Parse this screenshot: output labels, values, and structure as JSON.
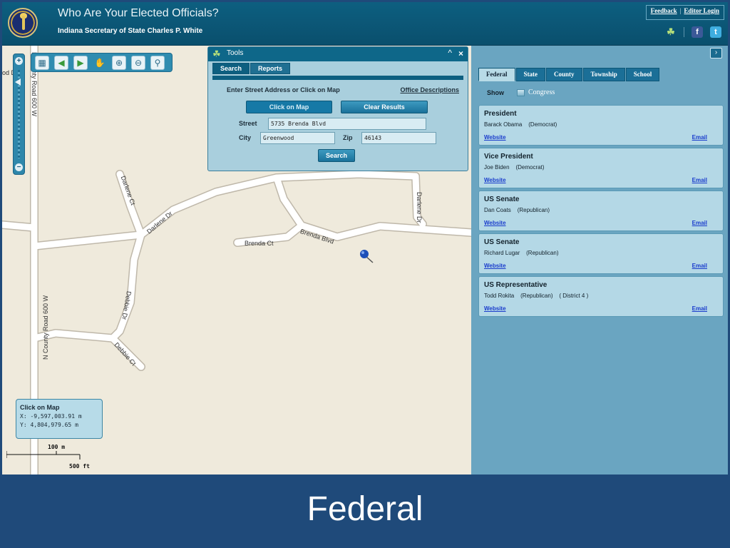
{
  "header": {
    "title": "Who Are Your Elected Officials?",
    "subtitle": "Indiana Secretary of State Charles P. White",
    "feedback": "Feedback",
    "separator": "|",
    "editor_login": "Editor Login"
  },
  "map": {
    "roads": [
      "N County Road 600 W",
      "N County Road 600 W",
      "Darlene Ct",
      "Darlene Dr",
      "Darlene Dr",
      "Brenda Blvd",
      "Brenda Ct",
      "Debbie Dr",
      "Debbie Ct",
      "od D"
    ],
    "coords": {
      "title": "Click on Map",
      "x": "X: -9,597,003.91 m",
      "y": "Y: 4,804,979.65 m"
    },
    "scale": {
      "metric": "100 m",
      "imperial": "500 ft"
    }
  },
  "tools": {
    "title": "Tools",
    "tabs": [
      "Search",
      "Reports"
    ],
    "enter_label": "Enter Street Address or Click on Map",
    "office_descriptions": "Office Descriptions",
    "click_on_map": "Click on Map",
    "clear_results": "Clear Results",
    "street_label": "Street",
    "street_value": "5735 Brenda Blvd",
    "city_label": "City",
    "city_value": "Greenwood",
    "zip_label": "Zip",
    "zip_value": "46143",
    "search": "Search"
  },
  "panel": {
    "tabs": [
      "Federal",
      "State",
      "County",
      "Township",
      "School"
    ],
    "show_label": "Show",
    "congress_label": "Congress",
    "officials": [
      {
        "office": "President",
        "detail": "Barack Obama    (Democrat)",
        "website": "Website",
        "email": "Email"
      },
      {
        "office": "Vice President",
        "detail": "Joe Biden    (Democrat)",
        "website": "Website",
        "email": "Email"
      },
      {
        "office": "US Senate",
        "detail": "Dan Coats    (Republican)",
        "website": "Website",
        "email": "Email"
      },
      {
        "office": "US Senate",
        "detail": "Richard Lugar    (Republican)",
        "website": "Website",
        "email": "Email"
      },
      {
        "office": "US Representative",
        "detail": "Todd Rokita    (Republican)    ( District 4 )",
        "website": "Website",
        "email": "Email"
      }
    ]
  },
  "caption": "Federal",
  "colors": {
    "header": "#0d5f80",
    "panel": "#6aa5c1",
    "card": "#b4d8e6",
    "link": "#1a3ccc",
    "caption_bg": "#1f4a7a"
  }
}
